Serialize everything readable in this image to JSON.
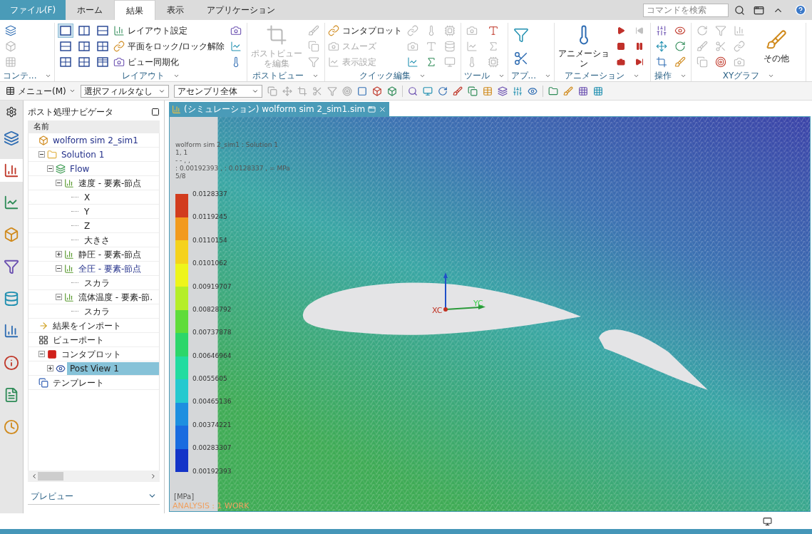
{
  "menu_tabs": [
    {
      "kind": "file",
      "label": "ファイル(F)",
      "selected": false
    },
    {
      "kind": "tab",
      "label": "ホーム",
      "selected": false
    },
    {
      "kind": "tab",
      "label": "結果",
      "selected": true
    },
    {
      "kind": "tab",
      "label": "表示",
      "selected": false
    },
    {
      "kind": "tab",
      "label": "アプリケーション",
      "selected": false
    }
  ],
  "command_search": {
    "placeholder": "コマンドを検索"
  },
  "ribbon_groups": [
    {
      "label": "コンテ...",
      "items": [
        {
          "kind": "icon",
          "disabled": false
        },
        {
          "kind": "icon",
          "disabled": true
        },
        {
          "kind": "icon",
          "disabled": true
        }
      ]
    },
    {
      "label": "レイアウト",
      "items": [
        {
          "kind": "layout",
          "selected": true
        },
        {
          "kind": "layout",
          "selected": false
        },
        {
          "kind": "layout",
          "selected": false
        },
        {
          "kind": "layout",
          "selected": false
        },
        {
          "kind": "layout",
          "selected": false
        },
        {
          "kind": "layout",
          "selected": false
        },
        {
          "kind": "layout",
          "selected": false
        },
        {
          "kind": "layout",
          "selected": false
        },
        {
          "kind": "layout",
          "selected": false
        },
        {
          "kind": "small",
          "label": "レイアウト設定",
          "disabled": false
        },
        {
          "kind": "small",
          "label": "平面をロック/ロック解除",
          "disabled": false
        },
        {
          "kind": "small",
          "label": "ビュー同期化",
          "disabled": false
        },
        {
          "kind": "icon",
          "disabled": false
        },
        {
          "kind": "icon",
          "disabled": false
        },
        {
          "kind": "icon",
          "disabled": false
        }
      ]
    },
    {
      "label": "ポストビュー",
      "items": [
        {
          "kind": "large",
          "label": "ポストビューを編集",
          "disabled": true
        },
        {
          "kind": "icon",
          "disabled": true
        },
        {
          "kind": "icon",
          "disabled": true
        },
        {
          "kind": "icon",
          "disabled": true
        }
      ]
    },
    {
      "label": "クイック編集",
      "items": [
        {
          "kind": "small",
          "label": "コンタプロット",
          "disabled": false
        },
        {
          "kind": "small",
          "label": "スムーズ",
          "disabled": true
        },
        {
          "kind": "small",
          "label": "表示設定",
          "disabled": true
        },
        {
          "kind": "icon",
          "disabled": true
        },
        {
          "kind": "icon",
          "disabled": true
        },
        {
          "kind": "icon",
          "disabled": false
        },
        {
          "kind": "icon",
          "disabled": true
        },
        {
          "kind": "icon",
          "disabled": true
        },
        {
          "kind": "icon",
          "disabled": false
        },
        {
          "kind": "icon",
          "disabled": true
        },
        {
          "kind": "icon",
          "disabled": true
        },
        {
          "kind": "icon",
          "disabled": true
        }
      ]
    },
    {
      "label": "ツール",
      "items": [
        {
          "kind": "icon",
          "disabled": true
        },
        {
          "kind": "icon",
          "disabled": true
        },
        {
          "kind": "icon",
          "disabled": true
        },
        {
          "kind": "icon",
          "disabled": false
        },
        {
          "kind": "icon",
          "disabled": true
        },
        {
          "kind": "icon",
          "disabled": true
        }
      ]
    },
    {
      "label": "アプ...",
      "items": [
        {
          "kind": "wide",
          "disabled": false
        },
        {
          "kind": "wide",
          "disabled": false
        }
      ]
    },
    {
      "label": "アニメーション",
      "items": [
        {
          "kind": "large",
          "label": "アニメーション",
          "disabled": false
        },
        {
          "kind": "anim",
          "disabled": false
        },
        {
          "kind": "anim",
          "disabled": false
        },
        {
          "kind": "anim",
          "disabled": false
        },
        {
          "kind": "anim",
          "disabled": true
        },
        {
          "kind": "anim",
          "disabled": false
        },
        {
          "kind": "anim",
          "disabled": false
        }
      ]
    },
    {
      "label": "操作",
      "items": [
        {
          "kind": "icon",
          "disabled": false
        },
        {
          "kind": "icon",
          "disabled": false
        },
        {
          "kind": "icon",
          "disabled": false
        },
        {
          "kind": "icon",
          "disabled": false
        },
        {
          "kind": "icon",
          "disabled": false
        },
        {
          "kind": "icon",
          "disabled": false
        }
      ]
    },
    {
      "label": "XYグラフ",
      "items": [
        {
          "kind": "icon",
          "disabled": true
        },
        {
          "kind": "icon",
          "disabled": true
        },
        {
          "kind": "icon",
          "disabled": true
        },
        {
          "kind": "icon",
          "disabled": true
        },
        {
          "kind": "icon",
          "disabled": true
        },
        {
          "kind": "icon",
          "disabled": false
        },
        {
          "kind": "icon",
          "disabled": true
        },
        {
          "kind": "icon",
          "disabled": true
        },
        {
          "kind": "icon",
          "disabled": true
        },
        {
          "kind": "large",
          "label": "その他",
          "disabled": false
        }
      ]
    }
  ],
  "toolbar": {
    "menu_label": "メニュー(M)",
    "filter": "選択フィルタなし",
    "scope": "アセンブリ全体"
  },
  "resource_bar": [
    {
      "selected": false
    },
    {
      "selected": true
    },
    {
      "selected": false
    },
    {
      "selected": false
    },
    {
      "selected": false
    },
    {
      "selected": false
    },
    {
      "selected": false
    },
    {
      "selected": false
    },
    {
      "selected": false
    },
    {
      "selected": false
    }
  ],
  "navigator": {
    "title": "ポスト処理ナビゲータ",
    "column": "名前",
    "preview": "プレビュー",
    "tree": [
      {
        "kind": "sim",
        "label": "wolform sim 2_sim1",
        "active": true,
        "selected": false,
        "children": [
          {
            "kind": "folder",
            "label": "Solution 1",
            "active": true,
            "selected": false,
            "expanded": true,
            "children": [
              {
                "kind": "solution",
                "label": "Flow",
                "active": true,
                "selected": false,
                "expanded": true,
                "children": [
                  {
                    "kind": "result",
                    "label": "速度 - 要素-節点",
                    "active": false,
                    "selected": false,
                    "expanded": true,
                    "children": [
                      {
                        "kind": "component",
                        "label": "X",
                        "active": false,
                        "selected": false
                      },
                      {
                        "kind": "component",
                        "label": "Y",
                        "active": false,
                        "selected": false
                      },
                      {
                        "kind": "component",
                        "label": "Z",
                        "active": false,
                        "selected": false
                      },
                      {
                        "kind": "component",
                        "label": "大きさ",
                        "active": false,
                        "selected": false
                      }
                    ]
                  },
                  {
                    "kind": "result",
                    "label": "静圧 - 要素-節点",
                    "active": false,
                    "selected": false,
                    "expanded": false
                  },
                  {
                    "kind": "result",
                    "label": "全圧 - 要素-節点",
                    "active": true,
                    "selected": false,
                    "expanded": true,
                    "children": [
                      {
                        "kind": "component",
                        "label": "スカラ",
                        "active": false,
                        "selected": false
                      }
                    ]
                  },
                  {
                    "kind": "result",
                    "label": "流体温度 - 要素-節.",
                    "active": false,
                    "selected": false,
                    "expanded": true,
                    "children": [
                      {
                        "kind": "component",
                        "label": "スカラ",
                        "active": false,
                        "selected": false
                      }
                    ]
                  }
                ]
              }
            ]
          }
        ]
      },
      {
        "kind": "import",
        "label": "結果をインポート",
        "active": false,
        "selected": false
      },
      {
        "kind": "viewport",
        "label": "ビューポート",
        "active": false,
        "selected": false,
        "children": [
          {
            "kind": "plot",
            "label": "コンタプロット",
            "active": false,
            "selected": false,
            "expanded": true,
            "children": [
              {
                "kind": "postview",
                "label": "Post View 1",
                "active": false,
                "selected": true,
                "expanded": false
              }
            ]
          }
        ]
      },
      {
        "kind": "template",
        "label": "テンプレート",
        "active": false,
        "selected": false
      }
    ]
  },
  "viewport": {
    "tab_title": "(シミュレーション) wolform sim 2_sim1.sim",
    "legend_header": [
      "wolform sim 2_sim1 : Solution 1",
      "1, 1",
      "- - , ,",
      ": 0.00192393 , : 0.0128337 , = MPa",
      "5/8"
    ],
    "legend_values": [
      "0.0128337",
      "0.0119245",
      "0.0110154",
      "0.0101062",
      "0.00919707",
      "0.00828792",
      "0.00737878",
      "0.00646964",
      "0.0055605",
      "0.00465136",
      "0.00374221",
      "0.00283307",
      "0.00192393"
    ],
    "unit": "[MPa]",
    "work_label": "ANALYSIS : 1 WORK",
    "x_axis": "XC",
    "y_axis": "YC"
  }
}
